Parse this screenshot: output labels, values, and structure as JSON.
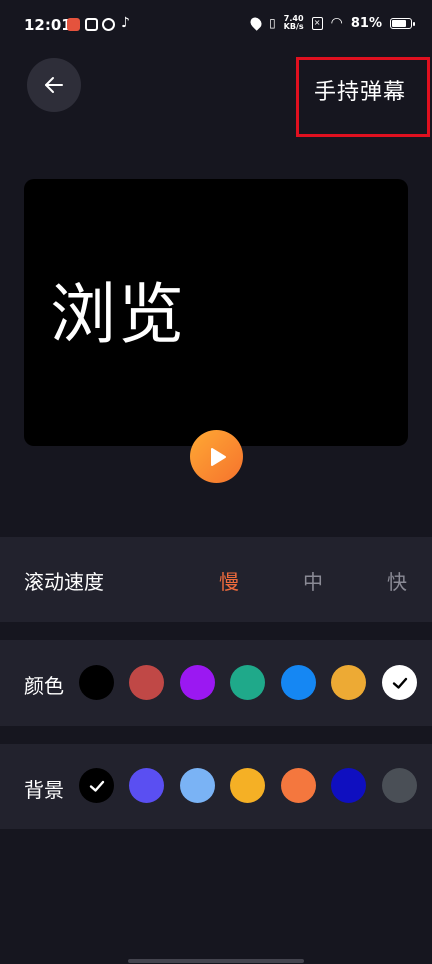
{
  "status_bar": {
    "time": "12:01",
    "net_speed_value": "7.40",
    "net_speed_unit": "KB/s",
    "battery_text": "81%",
    "battery_level": 0.81
  },
  "header": {
    "title": "手持弹幕"
  },
  "preview": {
    "text": "浏览"
  },
  "speed": {
    "label": "滚动速度",
    "options": [
      "慢",
      "中",
      "快"
    ],
    "selected": "慢",
    "active_color": "#f06b3c"
  },
  "text_color": {
    "label": "颜色",
    "swatches": [
      "#000000",
      "#c04846",
      "#9b18f2",
      "#1fa98a",
      "#1587f3",
      "#edaa34",
      "#ffffff"
    ],
    "selected_index": 6
  },
  "background_color": {
    "label": "背景",
    "swatches": [
      "#000000",
      "#5a4ff2",
      "#7ab3f5",
      "#f5b025",
      "#f4773e",
      "#0f0fc0",
      "#4a4f56"
    ],
    "selected_index": 0
  },
  "colors": {
    "page_bg": "#16161f",
    "row_bg": "#22222d",
    "highlight_border": "#e0101f"
  }
}
